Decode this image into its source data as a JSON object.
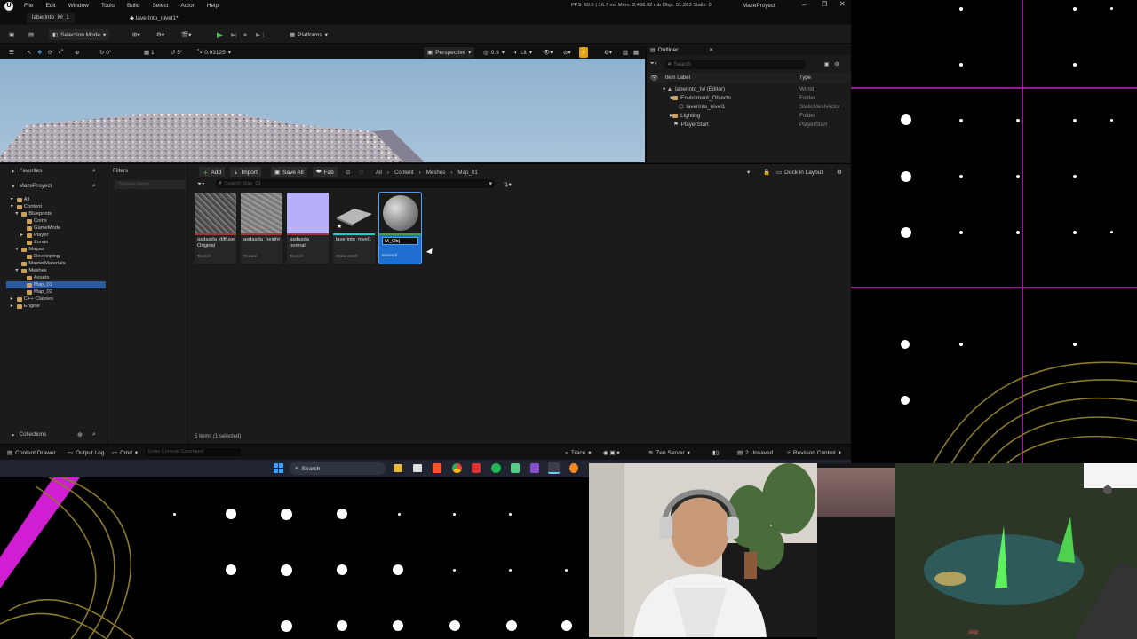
{
  "app": {
    "menu": [
      "File",
      "Edit",
      "Window",
      "Tools",
      "Build",
      "Select",
      "Actor",
      "Help"
    ],
    "level_tab": "laberinto_lvl_1",
    "asset_tab": "laverinto_nivel1*",
    "stats": "FPS: 60.0 | 16.7 ms  Mem: 2,436.92 mb  Objs: 51,283  Stalls: 0",
    "project_name": "MazeProyect"
  },
  "toolbar": {
    "selection_mode": "Selection Mode",
    "platforms": "Platforms"
  },
  "viewport": {
    "snap_value": "0.03125",
    "perspective": "Perspective",
    "lit": "Lit",
    "num1": "0.9"
  },
  "outliner": {
    "title": "Outliner",
    "search_placeholder": "Search",
    "col_label": "Item Label",
    "col_type": "Type",
    "rows": [
      {
        "label": "laberinto_lvl (Editor)",
        "type": "World"
      },
      {
        "label": "Enviroment_Objects",
        "type": "Folder"
      },
      {
        "label": "laverinto_nivel1",
        "type": "StaticMeshActor"
      },
      {
        "label": "Lighting",
        "type": "Folder"
      },
      {
        "label": "PlayerStart",
        "type": "PlayerStart"
      }
    ]
  },
  "content_browser": {
    "favorites": "Favorites",
    "project": "MazeProyect",
    "filters": "Filters",
    "filter_chip": "Skeletal Mesh",
    "add": "Add",
    "import": "Import",
    "save_all": "Save All",
    "fab": "Fab",
    "breadcrumb": [
      "All",
      "Content",
      "Meshes",
      "Map_01"
    ],
    "dock": "Dock in Layout",
    "search_placeholder": "Search Map_01",
    "tree": [
      "All",
      "Content",
      "Blueprints",
      "Coins",
      "GameMode",
      "Player",
      "Zonas",
      "Mapas",
      "Developing",
      "MasterMaterials",
      "Meshes",
      "Assets",
      "Map_01",
      "Map_02",
      "C++ Classes",
      "Engine"
    ],
    "collections": "Collections",
    "item_count": "5 items (1 selected)",
    "assets": [
      {
        "name": "asdasda_diffuse Original",
        "type": "Texture"
      },
      {
        "name": "asdasda_height",
        "type": "Texture"
      },
      {
        "name": "asdasda_ normal",
        "type": "Texture"
      },
      {
        "name": "laverinto_nivel1",
        "type": "Static Mesh"
      },
      {
        "name": "M_Obj",
        "type": "Material"
      }
    ]
  },
  "statusbar": {
    "content_drawer": "Content Drawer",
    "output_log": "Output Log",
    "cmd": "Cmd",
    "console_placeholder": "Enter Console Command",
    "trace": "Trace",
    "zen": "Zen Server",
    "unsaved": "2 Unsaved",
    "revision": "Revision Control"
  },
  "taskbar": {
    "search": "Search"
  },
  "overlay": {
    "stop_text": "stop"
  }
}
